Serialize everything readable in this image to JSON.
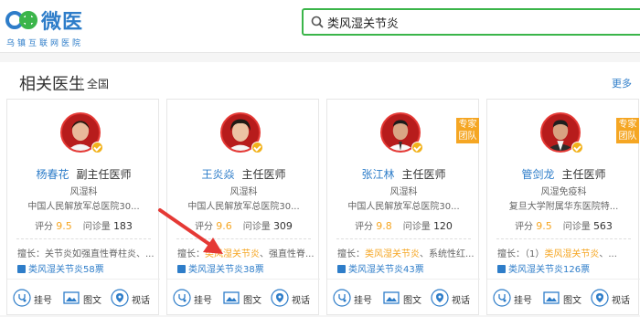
{
  "header": {
    "logo_text": "微医",
    "logo_sub": "乌镇互联网医院",
    "search_value": "类风湿关节炎"
  },
  "section": {
    "title": "相关医生",
    "scope": "全国",
    "more": "更多"
  },
  "colors": {
    "brand": "#2e7dc9",
    "accent": "#f5a623",
    "search_border": "#3bb54a",
    "annotation_arrow": "#e53935"
  },
  "doctors": [
    {
      "name": "杨春花",
      "title": "副主任医师",
      "dept": "风湿科",
      "hospital": "中国人民解放军总医院30...",
      "score_label": "评分",
      "score": "9.5",
      "count_label": "问诊量",
      "count": "183",
      "skill_label": "擅长：",
      "skill_highlight": "",
      "skill_rest": "关节炎如强直性脊柱炎、...",
      "vote": "类风湿关节炎58票",
      "team_badge": ""
    },
    {
      "name": "王炎焱",
      "title": "主任医师",
      "dept": "风湿科",
      "hospital": "中国人民解放军总医院30...",
      "score_label": "评分",
      "score": "9.6",
      "count_label": "问诊量",
      "count": "309",
      "skill_label": "擅长：",
      "skill_highlight": "类风湿关节炎",
      "skill_rest": "、强直性脊...",
      "vote": "类风湿关节炎38票",
      "team_badge": ""
    },
    {
      "name": "张江林",
      "title": "主任医师",
      "dept": "风湿科",
      "hospital": "中国人民解放军总医院30...",
      "score_label": "评分",
      "score": "9.8",
      "count_label": "问诊量",
      "count": "120",
      "skill_label": "擅长：",
      "skill_highlight": "类风湿关节炎",
      "skill_rest": "、系统性红...",
      "vote": "类风湿关节炎43票",
      "team_badge": "专家团队"
    },
    {
      "name": "管剑龙",
      "title": "主任医师",
      "dept": "风湿免疫科",
      "hospital": "复旦大学附属华东医院特...",
      "score_label": "评分",
      "score": "9.5",
      "count_label": "问诊量",
      "count": "563",
      "skill_label": "擅长：",
      "skill_highlight": "",
      "skill_rest": "（1）类风湿关节炎、...",
      "skill_pre": "（1）",
      "skill_hl2": "类风湿关节炎",
      "skill_post": "、...",
      "vote": "类风湿关节炎126票",
      "team_badge": "专家团队"
    }
  ],
  "actions": {
    "register": "挂号",
    "text_consult": "图文",
    "video": "视话"
  }
}
